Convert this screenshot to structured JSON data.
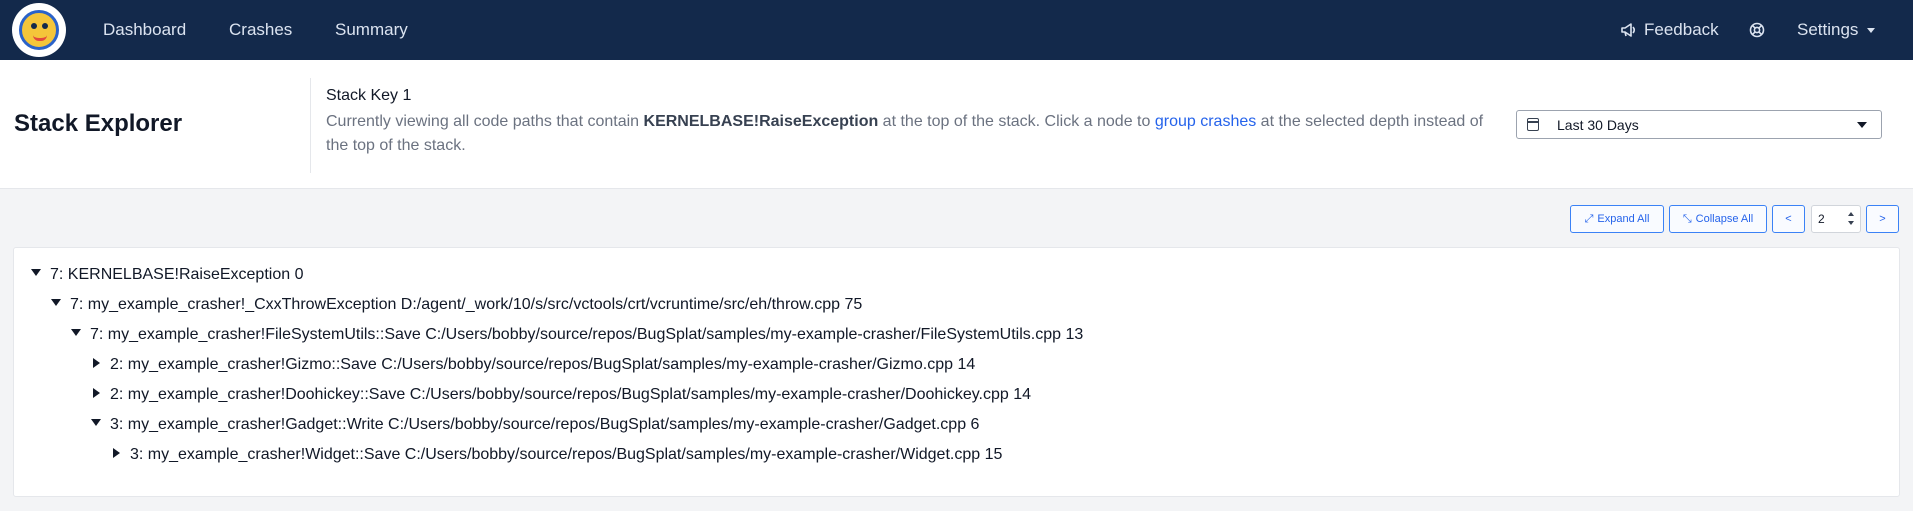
{
  "nav": {
    "links": [
      "Dashboard",
      "Crashes",
      "Summary"
    ],
    "feedback": "Feedback",
    "settings": "Settings"
  },
  "header": {
    "title": "Stack Explorer",
    "stack_key": "Stack Key 1",
    "desc_prefix": "Currently viewing all code paths that contain ",
    "desc_function": "KERNELBASE!RaiseException",
    "desc_middle": " at the top of the stack. Click a node to ",
    "desc_link": "group crashes",
    "desc_suffix": " at the selected depth instead of the top of the stack.",
    "date_range": "Last 30 Days"
  },
  "toolbar": {
    "expand_all": "Expand All",
    "collapse_all": "Collapse All",
    "prev": "<",
    "next": ">",
    "depth": "2"
  },
  "tree": [
    {
      "label": "7: KERNELBASE!RaiseException 0",
      "expanded": true,
      "level": 0
    },
    {
      "label": "7: my_example_crasher!_CxxThrowException D:/agent/_work/10/s/src/vctools/crt/vcruntime/src/eh/throw.cpp 75",
      "expanded": true,
      "level": 1
    },
    {
      "label": "7: my_example_crasher!FileSystemUtils::Save C:/Users/bobby/source/repos/BugSplat/samples/my-example-crasher/FileSystemUtils.cpp 13",
      "expanded": true,
      "level": 2
    },
    {
      "label": "2: my_example_crasher!Gizmo::Save C:/Users/bobby/source/repos/BugSplat/samples/my-example-crasher/Gizmo.cpp 14",
      "expanded": false,
      "level": 3
    },
    {
      "label": "2: my_example_crasher!Doohickey::Save C:/Users/bobby/source/repos/BugSplat/samples/my-example-crasher/Doohickey.cpp 14",
      "expanded": false,
      "level": 3
    },
    {
      "label": "3: my_example_crasher!Gadget::Write C:/Users/bobby/source/repos/BugSplat/samples/my-example-crasher/Gadget.cpp 6",
      "expanded": true,
      "level": 3
    },
    {
      "label": "3: my_example_crasher!Widget::Save C:/Users/bobby/source/repos/BugSplat/samples/my-example-crasher/Widget.cpp 15",
      "expanded": false,
      "level": 4
    }
  ]
}
